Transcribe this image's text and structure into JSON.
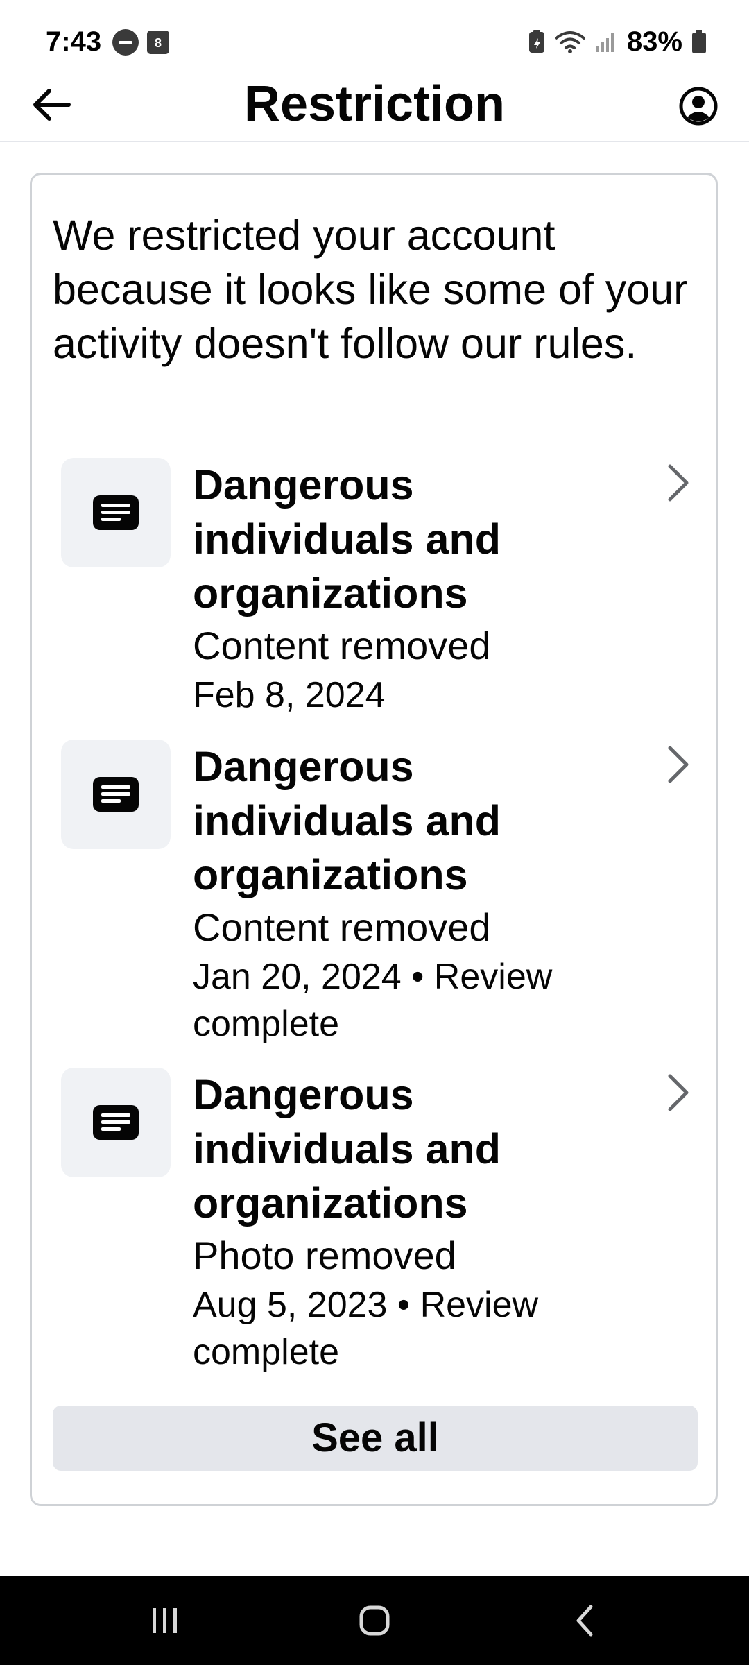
{
  "status_bar": {
    "time": "7:43",
    "calendar_badge": "8",
    "battery_percent": "83%"
  },
  "header": {
    "title": "Restriction",
    "back_icon": "arrow-left-icon",
    "profile_icon": "account-circle-icon"
  },
  "card": {
    "intro": "We restricted your account because it looks like some of your activity doesn't follow our rules.",
    "violations": [
      {
        "title": "Dangerous individuals and organizations",
        "status": "Content removed",
        "date": "Feb 8, 2024"
      },
      {
        "title": "Dangerous individuals and organizations",
        "status": "Content removed",
        "date": "Jan 20, 2024 • Review complete"
      },
      {
        "title": "Dangerous individuals and organizations",
        "status": "Photo removed",
        "date": "Aug 5, 2023 • Review complete"
      }
    ],
    "see_all_label": "See all"
  },
  "nav": {
    "recents_icon": "recents-icon",
    "home_icon": "home-icon",
    "back_icon": "nav-back-icon"
  },
  "colors": {
    "text": "#050505",
    "button_bg": "#e4e6eb",
    "thumb_bg": "#f0f2f5",
    "card_border": "#cfd2d6",
    "nav_bg": "#000000"
  }
}
